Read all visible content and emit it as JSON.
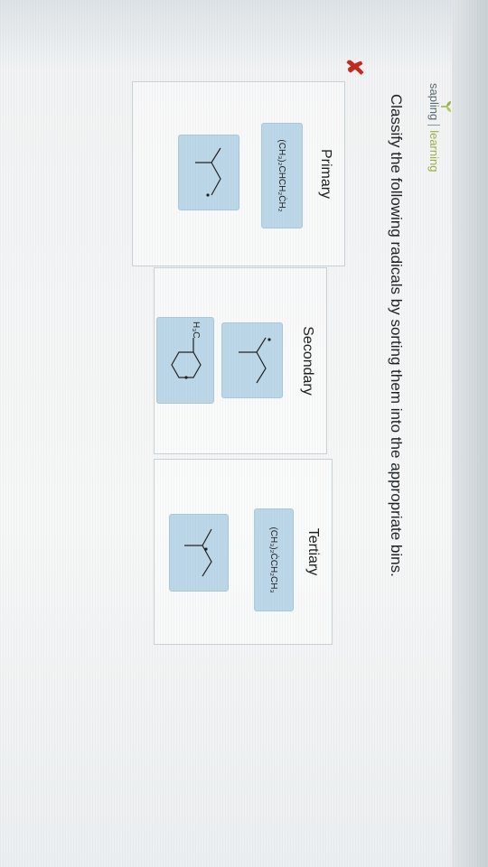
{
  "logo": {
    "brand": "sapling",
    "sub": "learning"
  },
  "question": {
    "prompt": "Classify the following radicals by sorting them into the appropriate bins.",
    "status_icon": "incorrect-x-icon",
    "status_color": "#c42a1e"
  },
  "bins": [
    {
      "label": "Primary",
      "items": [
        {
          "type": "formula",
          "text": "(CH₃)₂CHCH₂ĊH₂"
        },
        {
          "type": "structure",
          "icon": "isopentyl-radical-skeletal"
        }
      ]
    },
    {
      "label": "Secondary",
      "items": [
        {
          "type": "structure",
          "icon": "branched-secondary-radical-skeletal"
        },
        {
          "type": "structure",
          "icon": "methylcyclohexyl-radical-skeletal",
          "group_label": "H₃C"
        }
      ]
    },
    {
      "label": "Tertiary",
      "items": [
        {
          "type": "formula",
          "text": "(CH₃)₂ĊCH₂CH₃"
        },
        {
          "type": "structure",
          "icon": "tertiary-radical-skeletal"
        }
      ]
    }
  ],
  "colors": {
    "tile": "#bcd8e8",
    "accent": "#9bb14a"
  }
}
